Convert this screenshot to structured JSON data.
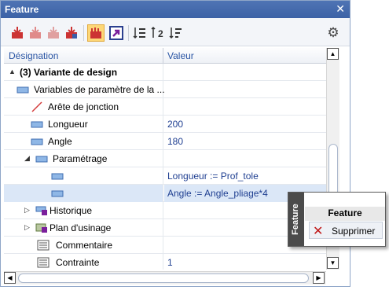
{
  "panel": {
    "title": "Feature",
    "close_glyph": "✕"
  },
  "toolbar": {
    "buttons": [
      {
        "name": "feature-tool-1-icon"
      },
      {
        "name": "feature-tool-2-icon"
      },
      {
        "name": "feature-tool-3-icon"
      },
      {
        "name": "feature-tool-4-icon"
      },
      {
        "name": "feature-active-tool-icon",
        "active": true
      },
      {
        "name": "arrow-link-icon"
      },
      {
        "name": "sort-ascending-icon",
        "glyph": "1"
      },
      {
        "name": "sort-descending-icon",
        "glyph": "2"
      },
      {
        "name": "sort-list-icon"
      }
    ],
    "settings_glyph": "⚙"
  },
  "grid": {
    "columns": [
      "Désignation",
      "Valeur"
    ],
    "rows": [
      {
        "label": "(3) Variante de design",
        "value": "",
        "bold": true,
        "expander": "▲"
      },
      {
        "label": "Variables de paramètre de la ...",
        "value": ""
      },
      {
        "label": "Arête de jonction",
        "value": ""
      },
      {
        "label": "Longueur",
        "value": "200"
      },
      {
        "label": "Angle",
        "value": "180"
      },
      {
        "label": "Paramétrage",
        "value": "",
        "expander": "◢"
      },
      {
        "label": "",
        "value": "Longueur := Prof_tole"
      },
      {
        "label": "",
        "value": "Angle := Angle_pliage*4",
        "selected": true
      },
      {
        "label": "Historique",
        "value": "",
        "expander": "▷"
      },
      {
        "label": "Plan d'usinage",
        "value": "",
        "expander": "▷"
      },
      {
        "label": "Commentaire",
        "value": ""
      },
      {
        "label": "Contrainte",
        "value": "1"
      }
    ]
  },
  "popup": {
    "side_label": "Feature",
    "header": "Feature",
    "item_label": "Supprimer",
    "item_glyph": "✕"
  },
  "scroll": {
    "up": "▲",
    "down": "▼",
    "left": "◀",
    "right": "▶"
  },
  "colors": {
    "titlebar": "#3c62a6",
    "header_text": "#2a55a4",
    "value_text": "#1f3f91",
    "selection": "#dbe7f7",
    "active_tool": "#fdd777"
  }
}
